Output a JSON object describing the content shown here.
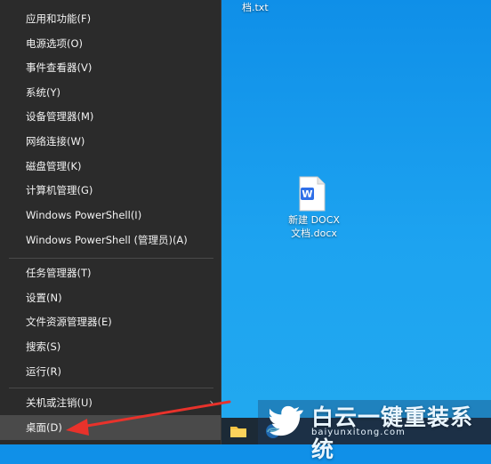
{
  "desktop": {
    "top_file_label": "档.txt",
    "doc_file_label_line1": "新建 DOCX",
    "doc_file_label_line2": "文档.docx"
  },
  "menu": {
    "group1": [
      "应用和功能(F)",
      "电源选项(O)",
      "事件查看器(V)",
      "系统(Y)",
      "设备管理器(M)",
      "网络连接(W)",
      "磁盘管理(K)",
      "计算机管理(G)",
      "Windows PowerShell(I)",
      "Windows PowerShell (管理员)(A)"
    ],
    "group2": [
      "任务管理器(T)",
      "设置(N)",
      "文件资源管理器(E)",
      "搜索(S)",
      "运行(R)"
    ],
    "shutdown_label": "关机或注销(U)",
    "desktop_label": "桌面(D)"
  },
  "watermark": {
    "title": "白云一键重装系统",
    "url": "baiyunxitong.com"
  },
  "colors": {
    "desktop": "#1a9cef",
    "menu_bg": "#2b2b2b",
    "highlight": "#4a4a4a",
    "arrow": "#e8322b"
  },
  "icons": [
    "doc-icon",
    "wps-w-icon",
    "folder-icon",
    "edge-icon",
    "chevron-right-icon",
    "twitter-bird-icon"
  ]
}
